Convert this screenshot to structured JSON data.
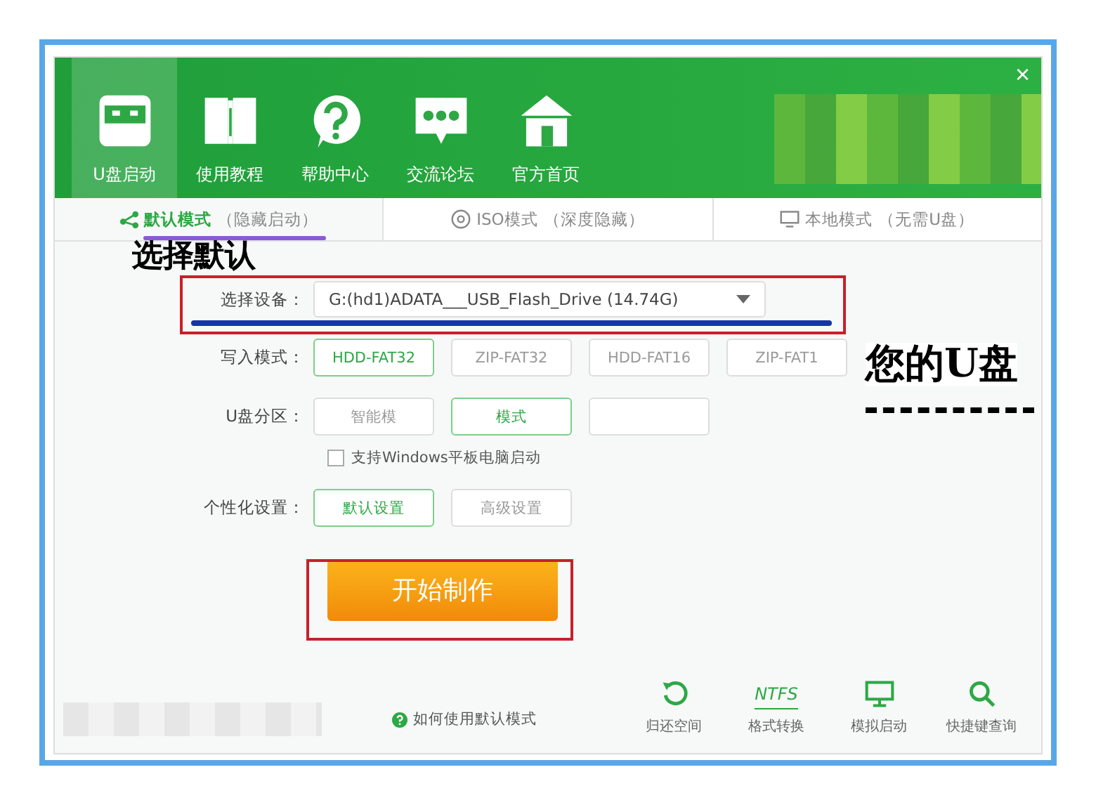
{
  "window": {
    "close": "×"
  },
  "nav": [
    {
      "label": "U盘启动",
      "kind": "drive",
      "selected": true
    },
    {
      "label": "使用教程",
      "kind": "book",
      "selected": false
    },
    {
      "label": "帮助中心",
      "kind": "help",
      "selected": false
    },
    {
      "label": "交流论坛",
      "kind": "chat",
      "selected": false
    },
    {
      "label": "官方首页",
      "kind": "home",
      "selected": false
    }
  ],
  "mode_tabs": [
    {
      "label": "默认模式",
      "note": "（隐藏启动）",
      "kind": "share",
      "selected": true
    },
    {
      "label": "ISO模式",
      "note": "（深度隐藏）",
      "kind": "disc",
      "selected": false
    },
    {
      "label": "本地模式",
      "note": "（无需U盘）",
      "kind": "monitor",
      "selected": false
    }
  ],
  "device": {
    "label": "选择设备：",
    "value": "G:(hd1)ADATA___USB_Flash_Drive (14.74G)"
  },
  "write_mode": {
    "label": "写入模式：",
    "options": [
      {
        "label": "HDD-FAT32",
        "selected": true
      },
      {
        "label": "ZIP-FAT32",
        "selected": false
      },
      {
        "label": "HDD-FAT16",
        "selected": false
      },
      {
        "label": "ZIP-FAT1",
        "selected": false
      }
    ]
  },
  "partition": {
    "label": "U盘分区：",
    "options": [
      {
        "label": "智能模",
        "selected": false
      },
      {
        "label": "模式",
        "selected": true
      },
      {
        "selected": false
      }
    ]
  },
  "tablet_boot": {
    "label": "支持Windows平板电脑启动",
    "checked": false
  },
  "personalize": {
    "label": "个性化设置：",
    "options": [
      {
        "label": "默认设置",
        "selected": true
      },
      {
        "label": "高级设置",
        "selected": false
      }
    ]
  },
  "start_button": "开始制作",
  "help_link": "如何使用默认模式",
  "tools": [
    {
      "label": "归还空间",
      "kind": "restore"
    },
    {
      "label": "格式转换",
      "kind": "ntfs",
      "icon_text": "NTFS"
    },
    {
      "label": "模拟启动",
      "kind": "monitor"
    },
    {
      "label": "快捷键查询",
      "kind": "search"
    }
  ],
  "annotations": {
    "default_note": "选择默认",
    "drive_note": "您的U盘"
  }
}
